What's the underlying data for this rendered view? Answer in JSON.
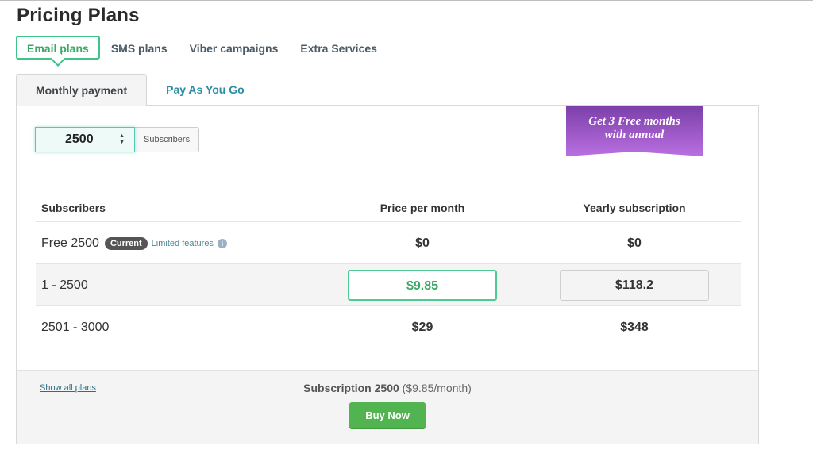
{
  "page": {
    "title": "Pricing Plans"
  },
  "plan_tabs": [
    {
      "label": "Email plans",
      "active": true
    },
    {
      "label": "SMS plans",
      "active": false
    },
    {
      "label": "Viber campaigns",
      "active": false
    },
    {
      "label": "Extra Services",
      "active": false
    }
  ],
  "payment_tabs": [
    {
      "label": "Monthly payment",
      "active": true
    },
    {
      "label": "Pay As You Go",
      "active": false
    }
  ],
  "subscribers_input": {
    "value": "2500",
    "unit_label": "Subscribers"
  },
  "promo": {
    "line1": "Get 3 Free months",
    "line2": "with annual"
  },
  "table": {
    "headers": {
      "subscribers": "Subscribers",
      "price": "Price per month",
      "yearly": "Yearly subscription"
    },
    "rows": [
      {
        "range": "Free 2500",
        "badge": "Current",
        "note": "Limited features",
        "info_icon": "info-icon",
        "price": "$0",
        "yearly": "$0"
      },
      {
        "range": "1 - 2500",
        "price": "$9.85",
        "yearly": "$118.2",
        "selected": true
      },
      {
        "range": "2501 - 3000",
        "price": "$29",
        "yearly": "$348"
      }
    ]
  },
  "footer": {
    "show_all_link": "Show all plans",
    "subscription_label": "Subscription 2500",
    "subscription_price": "($9.85/month)",
    "buy_button": "Buy Now"
  },
  "colors": {
    "accent_green": "#3aa866",
    "buy_button": "#52b450",
    "link_teal": "#2b8ca3",
    "promo_purple_top": "#7b3fa8",
    "promo_purple_bottom": "#b96fe0"
  }
}
